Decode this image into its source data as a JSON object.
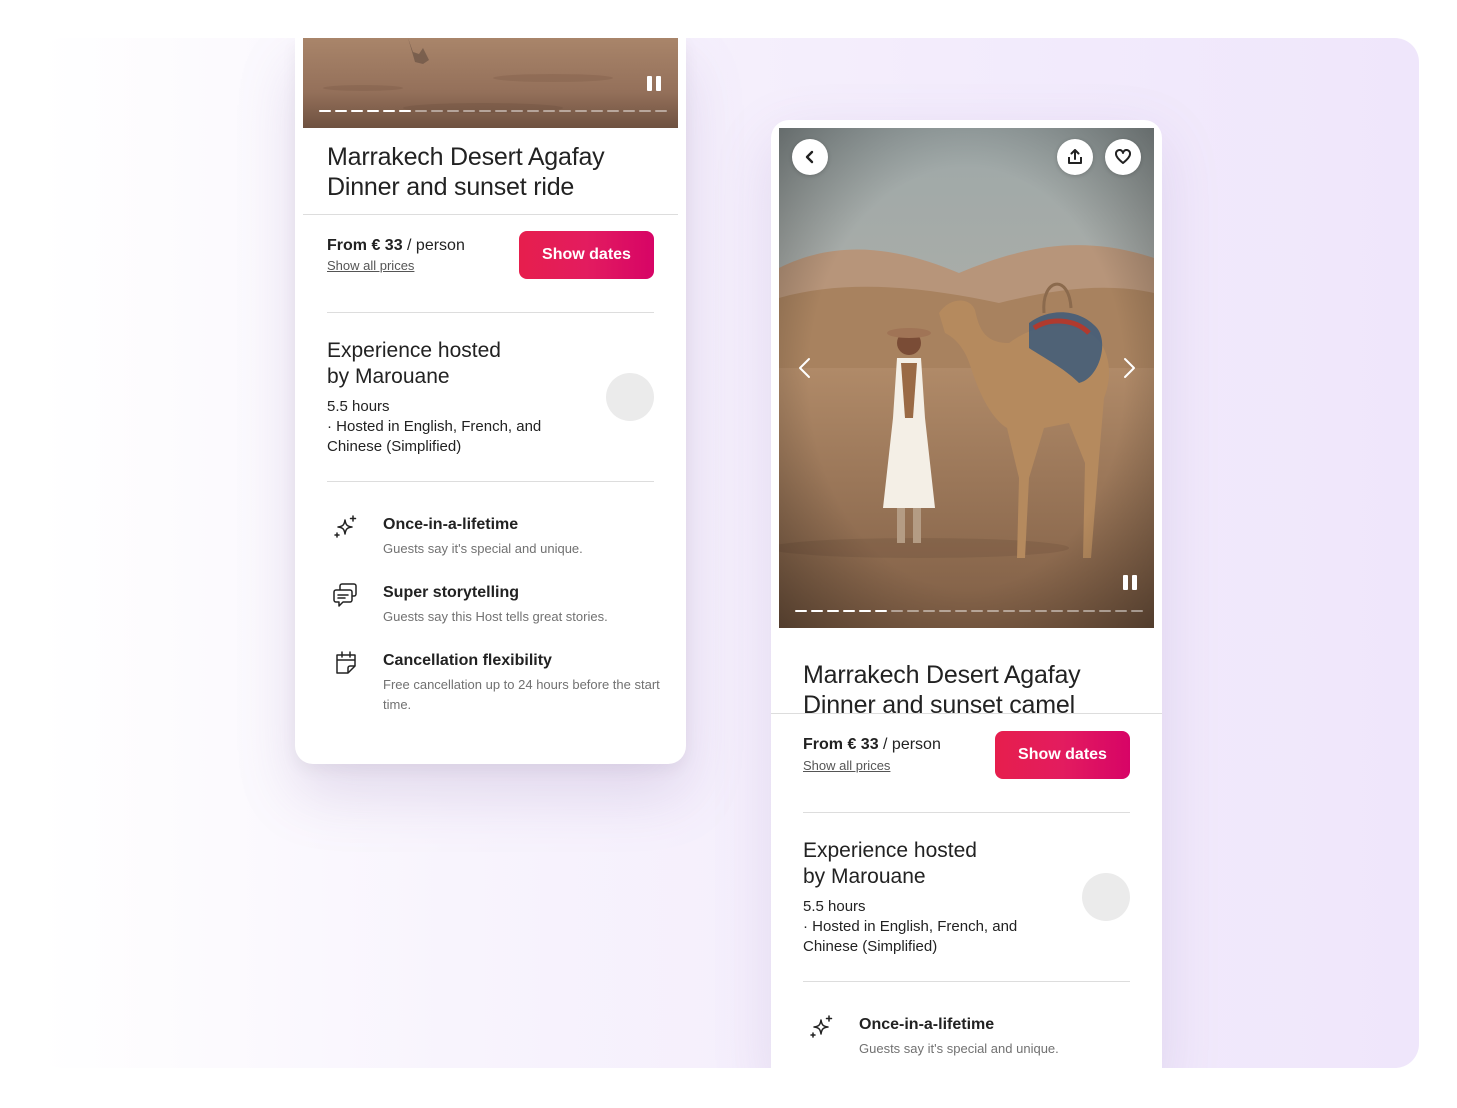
{
  "listing_left": {
    "title_line1": "Marrakech Desert Agafay",
    "title_line2": "Dinner and sunset ride",
    "price_from": "From € 33",
    "price_unit": " / person",
    "show_all_prices": "Show all prices",
    "show_dates": "Show dates",
    "host_title_line1": "Experience hosted",
    "host_title_line2": "by Marouane",
    "duration": "5.5 hours",
    "languages_line1": "·  Hosted in English, French, and",
    "languages_line2": "Chinese (Simplified)",
    "highlights": [
      {
        "icon": "sparkles-icon",
        "title": "Once-in-a-lifetime",
        "desc": "Guests say it's special and unique."
      },
      {
        "icon": "speech-bubbles-icon",
        "title": "Super storytelling",
        "desc": "Guests say this Host tells great stories."
      },
      {
        "icon": "calendar-icon",
        "title": "Cancellation flexibility",
        "desc": "Free cancellation up to 24 hours before the start time."
      }
    ],
    "carousel": {
      "total_slides": 22,
      "current_slide": 6
    }
  },
  "listing_right": {
    "title_line1": "Marrakech Desert Agafay",
    "title_line2": "Dinner and sunset camel",
    "price_from": "From € 33",
    "price_unit": " / person",
    "show_all_prices": "Show all prices",
    "show_dates": "Show dates",
    "host_title_line1": "Experience hosted",
    "host_title_line2": "by Marouane",
    "duration": "5.5 hours",
    "languages_line1": "·  Hosted in English, French, and",
    "languages_line2": "Chinese (Simplified)",
    "highlights": [
      {
        "icon": "sparkles-icon",
        "title": "Once-in-a-lifetime",
        "desc": "Guests say it's special and unique."
      }
    ],
    "carousel": {
      "total_slides": 22,
      "current_slide": 6
    },
    "buttons": [
      "back-icon",
      "share-icon",
      "heart-icon"
    ]
  },
  "colors": {
    "brand_gradient_start": "#e61e4d",
    "brand_gradient_end": "#d70466",
    "text_primary": "#222222",
    "text_secondary": "#717171",
    "divider": "#dddddd",
    "background_tint": "#efe6fb"
  }
}
